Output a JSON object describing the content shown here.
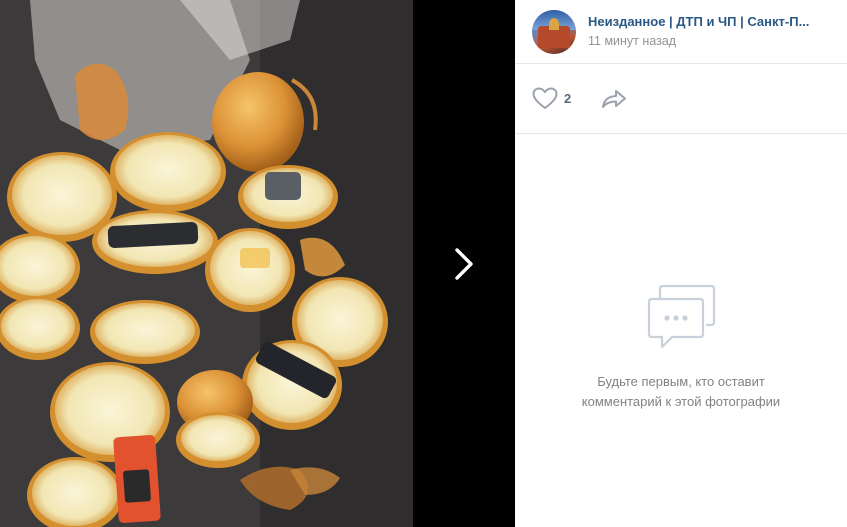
{
  "photo": {
    "description_icon": "photo-image"
  },
  "navigation": {
    "next_icon": "chevron-right-icon"
  },
  "post": {
    "author": "Неизданное | ДТП и ЧП | Санкт-П...",
    "time": "11 минут назад",
    "avatar_icon": "community-avatar"
  },
  "actions": {
    "like_icon": "heart-icon",
    "like_count": "2",
    "share_icon": "share-arrow-icon"
  },
  "comments": {
    "empty_icon": "comments-bubble-icon",
    "empty_line1": "Будьте первым, кто оставит",
    "empty_line2": "комментарий к этой фотографии"
  },
  "colors": {
    "link": "#2a5885",
    "muted": "#939393",
    "icon": "#99a2ad",
    "divider": "#e7e8ec"
  }
}
